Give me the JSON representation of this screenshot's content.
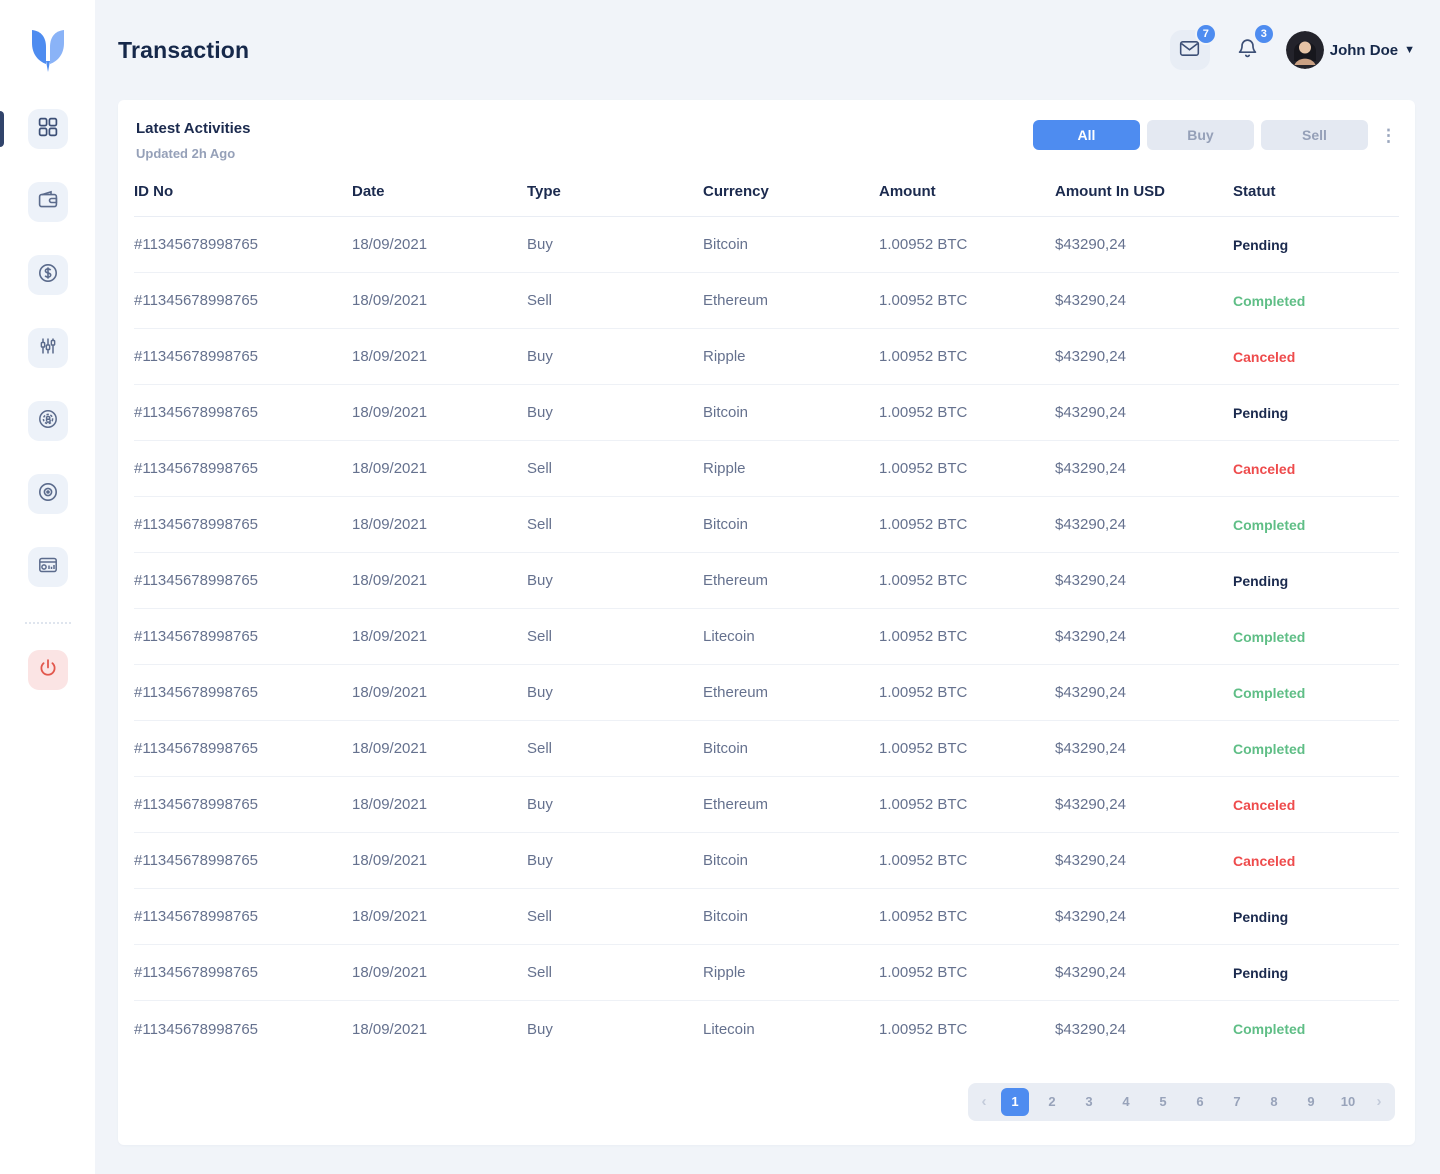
{
  "page": {
    "title": "Transaction"
  },
  "header": {
    "mail_badge": "7",
    "bell_badge": "3",
    "user_name": "John Doe",
    "icons": [
      "mail-icon",
      "bell-icon",
      "avatar",
      "chevron-down-icon"
    ]
  },
  "sidebar": {
    "icons": [
      "dashboard-icon",
      "wallet-icon",
      "money-icon",
      "market-chart-icon",
      "coin-icon",
      "disc-icon",
      "report-icon",
      "power-icon"
    ],
    "active_item": "dashboard"
  },
  "card": {
    "title": "Latest Activities",
    "subtitle": "Updated 2h Ago",
    "filters": [
      {
        "label": "All",
        "active": true
      },
      {
        "label": "Buy",
        "active": false
      },
      {
        "label": "Sell",
        "active": false
      }
    ],
    "kebab": "⋮"
  },
  "table": {
    "columns": [
      "ID No",
      "Date",
      "Type",
      "Currency",
      "Amount",
      "Amount In USD",
      "Statut"
    ],
    "rows": [
      {
        "id": "#11345678998765",
        "date": "18/09/2021",
        "type": "Buy",
        "currency": "Bitcoin",
        "amount": "1.00952 BTC",
        "usd": "$43290,24",
        "status": "Pending"
      },
      {
        "id": "#11345678998765",
        "date": "18/09/2021",
        "type": "Sell",
        "currency": "Ethereum",
        "amount": "1.00952 BTC",
        "usd": "$43290,24",
        "status": "Completed"
      },
      {
        "id": "#11345678998765",
        "date": "18/09/2021",
        "type": "Buy",
        "currency": "Ripple",
        "amount": "1.00952 BTC",
        "usd": "$43290,24",
        "status": "Canceled"
      },
      {
        "id": "#11345678998765",
        "date": "18/09/2021",
        "type": "Buy",
        "currency": "Bitcoin",
        "amount": "1.00952 BTC",
        "usd": "$43290,24",
        "status": "Pending"
      },
      {
        "id": "#11345678998765",
        "date": "18/09/2021",
        "type": "Sell",
        "currency": "Ripple",
        "amount": "1.00952 BTC",
        "usd": "$43290,24",
        "status": "Canceled"
      },
      {
        "id": "#11345678998765",
        "date": "18/09/2021",
        "type": "Sell",
        "currency": "Bitcoin",
        "amount": "1.00952 BTC",
        "usd": "$43290,24",
        "status": "Completed"
      },
      {
        "id": "#11345678998765",
        "date": "18/09/2021",
        "type": "Buy",
        "currency": "Ethereum",
        "amount": "1.00952 BTC",
        "usd": "$43290,24",
        "status": "Pending"
      },
      {
        "id": "#11345678998765",
        "date": "18/09/2021",
        "type": "Sell",
        "currency": "Litecoin",
        "amount": "1.00952 BTC",
        "usd": "$43290,24",
        "status": "Completed"
      },
      {
        "id": "#11345678998765",
        "date": "18/09/2021",
        "type": "Buy",
        "currency": "Ethereum",
        "amount": "1.00952 BTC",
        "usd": "$43290,24",
        "status": "Completed"
      },
      {
        "id": "#11345678998765",
        "date": "18/09/2021",
        "type": "Sell",
        "currency": "Bitcoin",
        "amount": "1.00952 BTC",
        "usd": "$43290,24",
        "status": "Completed"
      },
      {
        "id": "#11345678998765",
        "date": "18/09/2021",
        "type": "Buy",
        "currency": "Ethereum",
        "amount": "1.00952 BTC",
        "usd": "$43290,24",
        "status": "Canceled"
      },
      {
        "id": "#11345678998765",
        "date": "18/09/2021",
        "type": "Buy",
        "currency": "Bitcoin",
        "amount": "1.00952 BTC",
        "usd": "$43290,24",
        "status": "Canceled"
      },
      {
        "id": "#11345678998765",
        "date": "18/09/2021",
        "type": "Sell",
        "currency": "Bitcoin",
        "amount": "1.00952 BTC",
        "usd": "$43290,24",
        "status": "Pending"
      },
      {
        "id": "#11345678998765",
        "date": "18/09/2021",
        "type": "Sell",
        "currency": "Ripple",
        "amount": "1.00952 BTC",
        "usd": "$43290,24",
        "status": "Pending"
      },
      {
        "id": "#11345678998765",
        "date": "18/09/2021",
        "type": "Buy",
        "currency": "Litecoin",
        "amount": "1.00952 BTC",
        "usd": "$43290,24",
        "status": "Completed"
      }
    ]
  },
  "pagination": {
    "prev": "‹",
    "next": "›",
    "pages": [
      "1",
      "2",
      "3",
      "4",
      "5",
      "6",
      "7",
      "8",
      "9",
      "10"
    ],
    "active": "1"
  },
  "colors": {
    "accent_blue": "#4e8cf0",
    "status_pending": "#1b2a4e",
    "status_completed": "#5fbe86",
    "status_canceled": "#ee4b4c",
    "logout_red": "#e2574c"
  }
}
